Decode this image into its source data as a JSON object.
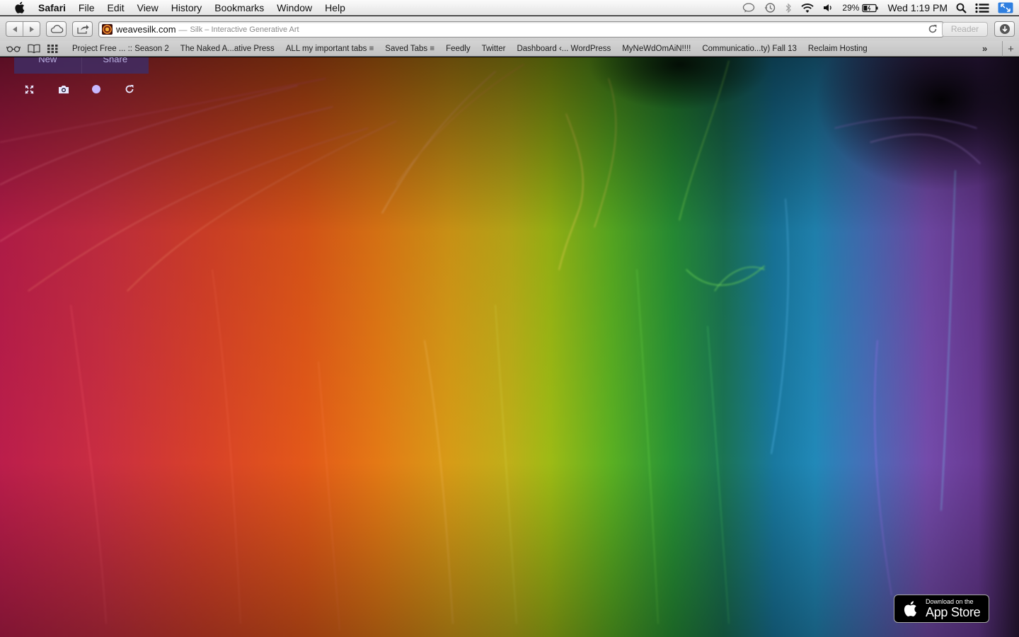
{
  "menubar": {
    "app": "Safari",
    "items": [
      "File",
      "Edit",
      "View",
      "History",
      "Bookmarks",
      "Window",
      "Help"
    ],
    "battery": "29%",
    "clock": "Wed 1:19 PM"
  },
  "toolbar": {
    "domain": "weavesilk.com",
    "separator": "—",
    "page_title": "Silk – Interactive Generative Art",
    "reader_label": "Reader"
  },
  "bookmarks": [
    "Project Free ... :: Season 2",
    "The Naked A...ative Press",
    "ALL my important tabs ≡",
    "Saved Tabs ≡",
    "Feedly",
    "Twitter",
    "Dashboard ‹... WordPress",
    "MyNeWdOmAiN!!!!",
    "Communicatio...ty) Fall 13",
    "Reclaim Hosting"
  ],
  "page": {
    "new_label": "New",
    "share_label": "Share",
    "appstore_small": "Download on the",
    "appstore_big": "App Store"
  }
}
